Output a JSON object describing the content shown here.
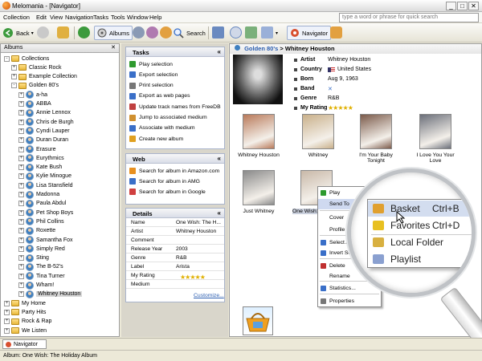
{
  "window": {
    "title": "Melomania - [Navigator]",
    "min": "_",
    "max": "□",
    "close": "✕"
  },
  "menu": {
    "items": [
      "Collection",
      "Edit",
      "View",
      "Navigation",
      "Tasks",
      "Tools",
      "Window",
      "Help"
    ],
    "search_placeholder": "type a word or phrase for quick search"
  },
  "toolbar": {
    "back": "Back",
    "albums": "Albums",
    "search": "Search",
    "navigator": "Navigator"
  },
  "left": {
    "header": "Albums",
    "tree": [
      {
        "label": "Collections",
        "level": 0,
        "kind": "folder",
        "exp": "-"
      },
      {
        "label": "Classic Rock",
        "level": 1,
        "kind": "folder",
        "exp": "+"
      },
      {
        "label": "Example Collection",
        "level": 1,
        "kind": "folder",
        "exp": "+"
      },
      {
        "label": "Golden 80's",
        "level": 1,
        "kind": "folder",
        "exp": "-"
      },
      {
        "label": "a-ha",
        "level": 2,
        "kind": "person",
        "exp": "+"
      },
      {
        "label": "ABBA",
        "level": 2,
        "kind": "person",
        "exp": "+"
      },
      {
        "label": "Annie Lennox",
        "level": 2,
        "kind": "person",
        "exp": "+"
      },
      {
        "label": "Chris de Burgh",
        "level": 2,
        "kind": "person",
        "exp": "+"
      },
      {
        "label": "Cyndi Lauper",
        "level": 2,
        "kind": "person",
        "exp": "+"
      },
      {
        "label": "Duran Duran",
        "level": 2,
        "kind": "person",
        "exp": "+"
      },
      {
        "label": "Erasure",
        "level": 2,
        "kind": "person",
        "exp": "+"
      },
      {
        "label": "Eurythmics",
        "level": 2,
        "kind": "person",
        "exp": "+"
      },
      {
        "label": "Kate Bush",
        "level": 2,
        "kind": "person",
        "exp": "+"
      },
      {
        "label": "Kylie Minogue",
        "level": 2,
        "kind": "person",
        "exp": "+"
      },
      {
        "label": "Lisa Stansfield",
        "level": 2,
        "kind": "person",
        "exp": "+"
      },
      {
        "label": "Madonna",
        "level": 2,
        "kind": "person",
        "exp": "+"
      },
      {
        "label": "Paula Abdul",
        "level": 2,
        "kind": "person",
        "exp": "+"
      },
      {
        "label": "Pet Shop Boys",
        "level": 2,
        "kind": "person",
        "exp": "+"
      },
      {
        "label": "Phil Collins",
        "level": 2,
        "kind": "person",
        "exp": "+"
      },
      {
        "label": "Roxette",
        "level": 2,
        "kind": "person",
        "exp": "+"
      },
      {
        "label": "Samantha Fox",
        "level": 2,
        "kind": "person",
        "exp": "+"
      },
      {
        "label": "Simply Red",
        "level": 2,
        "kind": "person",
        "exp": "+"
      },
      {
        "label": "Sting",
        "level": 2,
        "kind": "person",
        "exp": "+"
      },
      {
        "label": "The B-52's",
        "level": 2,
        "kind": "person",
        "exp": "+"
      },
      {
        "label": "Tina Turner",
        "level": 2,
        "kind": "person",
        "exp": "+"
      },
      {
        "label": "Wham!",
        "level": 2,
        "kind": "person",
        "exp": "+"
      },
      {
        "label": "Whitney Houston",
        "level": 2,
        "kind": "person",
        "exp": "+",
        "selected": true
      },
      {
        "label": "My Home",
        "level": 0,
        "kind": "folder",
        "exp": "+"
      },
      {
        "label": "Party Hits",
        "level": 0,
        "kind": "folder",
        "exp": "+"
      },
      {
        "label": "Rock & Rap",
        "level": 0,
        "kind": "folder",
        "exp": "+"
      },
      {
        "label": "We Listen",
        "level": 0,
        "kind": "folder",
        "exp": "+"
      }
    ]
  },
  "tasks": {
    "header": "Tasks",
    "items": [
      {
        "label": "Play selection",
        "color": "#2e9a2e"
      },
      {
        "label": "Export selection",
        "color": "#3a6fc8"
      },
      {
        "label": "Print selection",
        "color": "#777777"
      },
      {
        "label": "Export as web pages",
        "color": "#3a6fc8"
      },
      {
        "label": "Update track names from FreeDB",
        "color": "#c04040"
      },
      {
        "label": "Jump to associated medium",
        "color": "#d09030"
      },
      {
        "label": "Associate with medium",
        "color": "#3a6fc8"
      },
      {
        "label": "Create new album",
        "color": "#e0a020"
      }
    ]
  },
  "web": {
    "header": "Web",
    "items": [
      "Search for album in Amazon.com",
      "Search for album in AMG",
      "Search for album in Google"
    ]
  },
  "details": {
    "header": "Details",
    "rows": [
      {
        "k": "Name",
        "v": "One Wish: The H..."
      },
      {
        "k": "Artist",
        "v": "Whitney Houston"
      },
      {
        "k": "Comment",
        "v": ""
      },
      {
        "k": "Release Year",
        "v": "2003"
      },
      {
        "k": "Genre",
        "v": "R&B"
      },
      {
        "k": "Label",
        "v": "Arista"
      },
      {
        "k": "My Rating",
        "v": ""
      },
      {
        "k": "Medium",
        "v": ""
      }
    ],
    "rating": "★★★★★",
    "customize": "Customize..."
  },
  "right": {
    "crumb_parent": "Golden 80's",
    "crumb_sep": ">",
    "crumb_current": "Whitney Houston",
    "info": [
      {
        "k": "Artist",
        "v": "Whitney Houston"
      },
      {
        "k": "Country",
        "v": "United States"
      },
      {
        "k": "Born",
        "v": "Aug 9, 1963"
      },
      {
        "k": "Band",
        "v": "✕"
      },
      {
        "k": "Genre",
        "v": "R&B"
      },
      {
        "k": "My Rating",
        "v": "★★★★★"
      }
    ],
    "albums": [
      {
        "title": "Whitney Houston",
        "color": "#b97a5a"
      },
      {
        "title": "Whitney",
        "color": "#c9b08a"
      },
      {
        "title": "I'm Your Baby Tonight",
        "color": "#7b5a4a"
      },
      {
        "title": "I Love You Your Love",
        "color": "#6b6f7a"
      },
      {
        "title": "Just Whitney",
        "color": "#8a8a8a"
      },
      {
        "title": "One Wish: The",
        "color": "#c8b8a8"
      }
    ]
  },
  "context_menu": {
    "items": [
      {
        "label": "Play",
        "hl": false
      },
      {
        "label": "Send To",
        "hl": true
      },
      {
        "label": "Cover",
        "hl": false
      },
      {
        "label": "Profile",
        "hl": false
      },
      {
        "label": "Select All",
        "hl": false
      },
      {
        "label": "Invert Selection",
        "hl": false
      },
      {
        "label": "Delete",
        "hl": false
      },
      {
        "label": "Rename",
        "hl": false
      },
      {
        "label": "Statistics...",
        "hl": false
      },
      {
        "label": "Properties",
        "hl": false
      }
    ]
  },
  "submenu": {
    "items": [
      {
        "label": "Basket",
        "shortcut": "Ctrl+B",
        "hl": true
      },
      {
        "label": "Favorites",
        "shortcut": "Ctrl+D",
        "hl": false
      },
      {
        "label": "Local Folder",
        "shortcut": "",
        "hl": false
      },
      {
        "label": "Playlist",
        "shortcut": "",
        "hl": false
      }
    ]
  },
  "bottom_tab": "Navigator",
  "status": "Album: One Wish: The Holiday Album"
}
